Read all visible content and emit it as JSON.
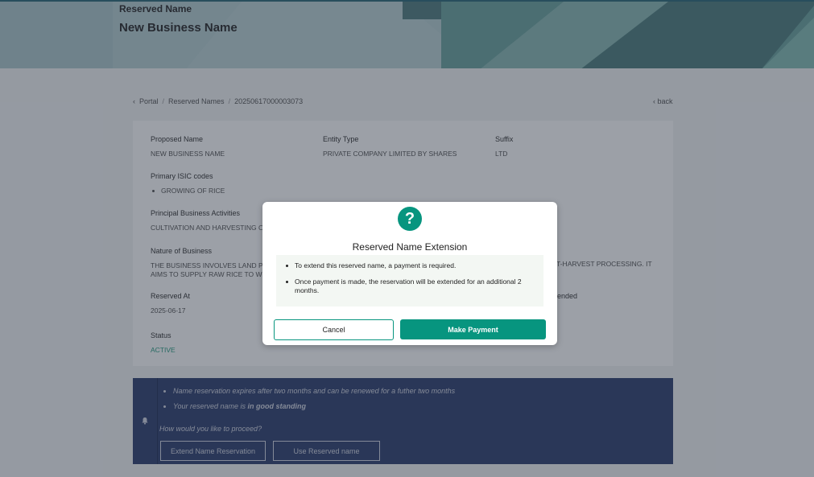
{
  "header": {
    "label": "Reserved Name",
    "title": "New Business Name"
  },
  "breadcrumb": {
    "items": [
      "Portal",
      "Reserved Names",
      "20250617000003073"
    ],
    "back_label": "back"
  },
  "details": {
    "proposed_name": {
      "label": "Proposed Name",
      "value": "NEW BUSINESS NAME"
    },
    "entity_type": {
      "label": "Entity Type",
      "value": "PRIVATE COMPANY LIMITED BY SHARES"
    },
    "suffix": {
      "label": "Suffix",
      "value": "LTD"
    },
    "isic": {
      "label": "Primary ISIC codes",
      "items": [
        "GROWING OF RICE"
      ]
    },
    "activities": {
      "label": "Principal Business Activities",
      "value": "CULTIVATION AND HARVESTING OF"
    },
    "nature": {
      "label": "Nature of Business",
      "value_left": "THE BUSINESS INVOLVES LAND PREC",
      "value_left_2": "AIMS TO SUPPLY RAW RICE TO WHO",
      "value_right": "T-HARVEST PROCESSING. IT"
    },
    "reserved_at": {
      "label": "Reserved At",
      "value": "2025-06-17"
    },
    "extended_label_fragment": "ended",
    "status": {
      "label": "Status",
      "value": "ACTIVE"
    }
  },
  "info": {
    "bullets": [
      {
        "text": "Name reservation expires after two months and can be renewed for a futher two months"
      },
      {
        "prefix": "Your reserved name is ",
        "bold": "in good standing"
      }
    ],
    "question": "How would you like to proceed?",
    "extend_button": "Extend Name Reservation",
    "use_button": "Use Reserved name"
  },
  "modal": {
    "icon": "question-icon",
    "title": "Reserved Name Extension",
    "points": [
      "To extend this reserved name, a payment is required.",
      "Once payment is made, the reservation will be extended for an additional 2 months."
    ],
    "cancel_label": "Cancel",
    "pay_label": "Make Payment"
  },
  "colors": {
    "accent": "#07957f",
    "info_panel": "#31406f",
    "status_active": "#2a9d82"
  }
}
